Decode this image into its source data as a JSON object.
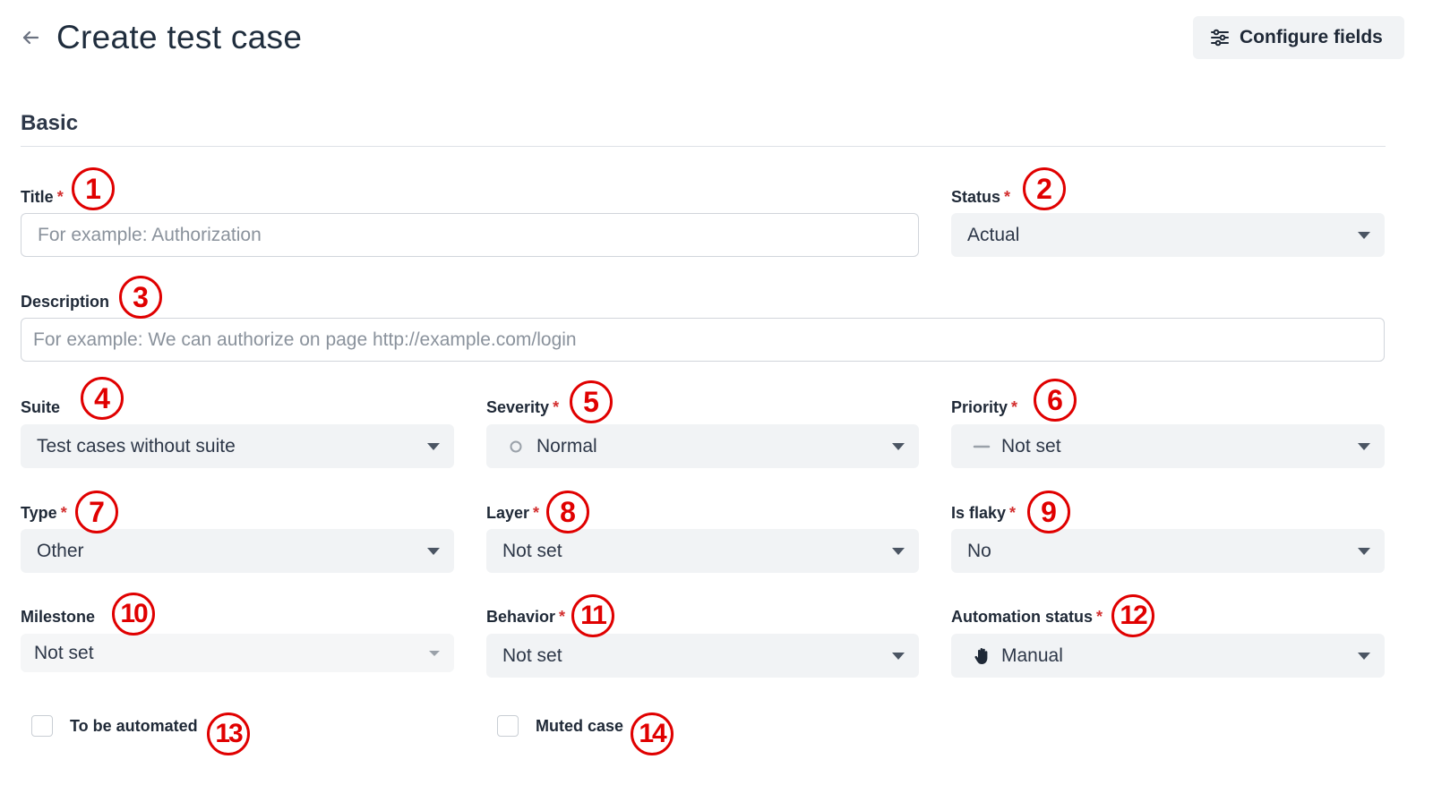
{
  "header": {
    "title": "Create test case",
    "back_icon": "arrow-left-icon",
    "configure_label": "Configure fields",
    "configure_icon": "sliders-icon"
  },
  "section": {
    "title": "Basic"
  },
  "fields": {
    "title": {
      "label": "Title",
      "required": "*",
      "placeholder": "For example: Authorization",
      "value": ""
    },
    "status": {
      "label": "Status",
      "required": "*",
      "value": "Actual"
    },
    "description": {
      "label": "Description",
      "placeholder": "For example: We can authorize on page http://example.com/login",
      "value": ""
    },
    "suite": {
      "label": "Suite",
      "value": "Test cases without suite"
    },
    "severity": {
      "label": "Severity",
      "required": "*",
      "value": "Normal",
      "icon": "circle-outline-icon"
    },
    "priority": {
      "label": "Priority",
      "required": "*",
      "value": "Not set",
      "icon": "dash-icon"
    },
    "type": {
      "label": "Type",
      "required": "*",
      "value": "Other"
    },
    "layer": {
      "label": "Layer",
      "required": "*",
      "value": "Not set"
    },
    "is_flaky": {
      "label": "Is flaky",
      "required": "*",
      "value": "No"
    },
    "milestone": {
      "label": "Milestone",
      "value": "Not set"
    },
    "behavior": {
      "label": "Behavior",
      "required": "*",
      "value": "Not set"
    },
    "automation_status": {
      "label": "Automation status",
      "required": "*",
      "value": "Manual",
      "icon": "hand-icon"
    }
  },
  "checkboxes": {
    "to_be_automated": {
      "label": "To be automated",
      "checked": false
    },
    "muted_case": {
      "label": "Muted case",
      "checked": false
    }
  },
  "markers": [
    "1",
    "2",
    "3",
    "4",
    "5",
    "6",
    "7",
    "8",
    "9",
    "10",
    "11",
    "12",
    "13",
    "14"
  ],
  "colors": {
    "required": "#d32f2f",
    "marker": "#e00000",
    "select_bg": "#f1f3f5"
  }
}
